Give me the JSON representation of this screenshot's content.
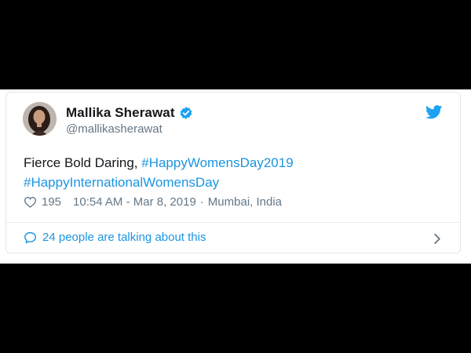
{
  "tweet": {
    "display_name": "Mallika Sherawat",
    "handle": "@mallikasherawat",
    "text_plain": "Fierce Bold Daring, ",
    "hashtag_1": "#HappyWomensDay2019",
    "hashtag_2": "#HappyInternationalWomensDay",
    "likes": "195",
    "time": "10:54 AM - Mar 8, 2019",
    "separator": "·",
    "location": "Mumbai, India",
    "talking": "24 people are talking about this"
  },
  "icons": {
    "avatar": "profile-photo",
    "verified": "verified-badge-icon",
    "bird": "twitter-bird-icon",
    "like": "heart-icon",
    "replies": "speech-bubble-icon",
    "more": "chevron-right-icon"
  },
  "colors": {
    "accent": "#1b95e0",
    "text": "#14171a",
    "muted": "#657786",
    "verified": "#1da1f2"
  }
}
